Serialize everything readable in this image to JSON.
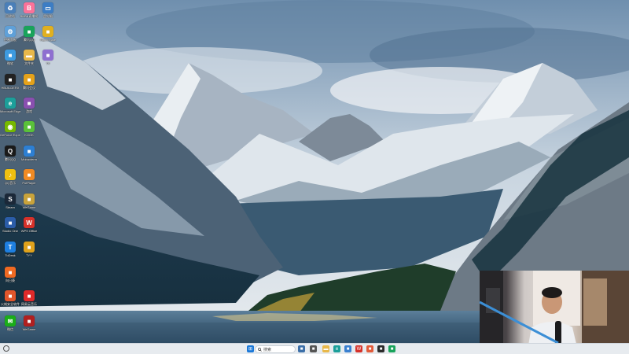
{
  "desktop": {
    "icons": [
      {
        "label": "回收站",
        "icon": "recycle-bin-icon",
        "color": "#4a7fb8"
      },
      {
        "label": "BiliBili直播姬",
        "icon": "bilibili-icon",
        "color": "#fb7299"
      },
      {
        "label": "此电脑",
        "icon": "computer-icon",
        "color": "#3c7dc4"
      },
      {
        "label": "控制面板",
        "icon": "control-panel-icon",
        "color": "#5fa0d8"
      },
      {
        "label": "腾讯QQ",
        "icon": "app-icon",
        "color": "#19a35b"
      },
      {
        "label": "Nightingale",
        "icon": "app-icon",
        "color": "#e0b020"
      },
      {
        "label": "微软",
        "icon": "app-icon",
        "color": "#3d9be0"
      },
      {
        "label": "文件夹",
        "icon": "folder-icon",
        "color": "#e8b84a"
      },
      {
        "label": "TV",
        "icon": "app-icon",
        "color": "#8e6fd0"
      },
      {
        "label": "HBUILDERX",
        "icon": "app-icon",
        "color": "#222222"
      },
      {
        "label": "腾讯会议",
        "icon": "app-icon",
        "color": "#e5a21a"
      },
      {
        "label": "Microsoft Edge",
        "icon": "edge-icon",
        "color": "#1c9f9a"
      },
      {
        "label": "游戏",
        "icon": "app-icon",
        "color": "#8a4fb0"
      },
      {
        "label": "GeForce Experience",
        "icon": "nvidia-icon",
        "color": "#76b900"
      },
      {
        "label": "KOOK",
        "icon": "app-icon",
        "color": "#5ac13a"
      },
      {
        "label": "腾讯QQ",
        "icon": "qq-icon",
        "color": "#1a1a1a"
      },
      {
        "label": "Mobaxterm",
        "icon": "app-icon",
        "color": "#2d7fd3"
      },
      {
        "label": "QQ音乐",
        "icon": "music-icon",
        "color": "#f0c010"
      },
      {
        "label": "PotPlayer",
        "icon": "app-icon",
        "color": "#f08a24"
      },
      {
        "label": "Steam",
        "icon": "steam-icon",
        "color": "#1b2838"
      },
      {
        "label": "WeGame",
        "icon": "app-icon",
        "color": "#c9a33b"
      },
      {
        "label": "Studio One",
        "icon": "app-icon",
        "color": "#2b5da8"
      },
      {
        "label": "WPS Office",
        "icon": "wps-icon",
        "color": "#d6312a"
      },
      {
        "label": "ToDesk",
        "icon": "todesk-icon",
        "color": "#1e7fe0"
      },
      {
        "label": "TYY",
        "icon": "app-icon",
        "color": "#e0a21c"
      },
      {
        "label": "向日葵",
        "icon": "app-icon",
        "color": "#f06a22"
      },
      {
        "label": "火绒安全软件",
        "icon": "app-icon",
        "color": "#e2562b"
      },
      {
        "label": "网易云音乐",
        "icon": "app-icon",
        "color": "#e02a2a"
      },
      {
        "label": "微信",
        "icon": "wechat-icon",
        "color": "#1aad19"
      },
      {
        "label": "WeGame",
        "icon": "app-icon",
        "color": "#b02020"
      }
    ]
  },
  "taskbar": {
    "search_placeholder": "搜索",
    "apps": [
      {
        "name": "start-button",
        "icon": "windows-icon",
        "color": "#1a78d8"
      },
      {
        "name": "taskbar-app-1",
        "icon": "app-icon",
        "color": "#3c6fa8"
      },
      {
        "name": "taskbar-app-2",
        "icon": "app-icon",
        "color": "#555555"
      },
      {
        "name": "taskbar-app-3",
        "icon": "folder-icon",
        "color": "#e8b84a"
      },
      {
        "name": "taskbar-app-4",
        "icon": "edge-icon",
        "color": "#1c9f9a"
      },
      {
        "name": "taskbar-app-5",
        "icon": "app-icon",
        "color": "#3a80d0"
      },
      {
        "name": "taskbar-app-6",
        "icon": "wps-icon",
        "color": "#d6312a"
      },
      {
        "name": "taskbar-app-7",
        "icon": "app-icon",
        "color": "#e25b3a"
      },
      {
        "name": "taskbar-app-8",
        "icon": "app-icon",
        "color": "#2b2b2b"
      },
      {
        "name": "taskbar-app-9",
        "icon": "app-icon",
        "color": "#19a35b"
      }
    ]
  }
}
